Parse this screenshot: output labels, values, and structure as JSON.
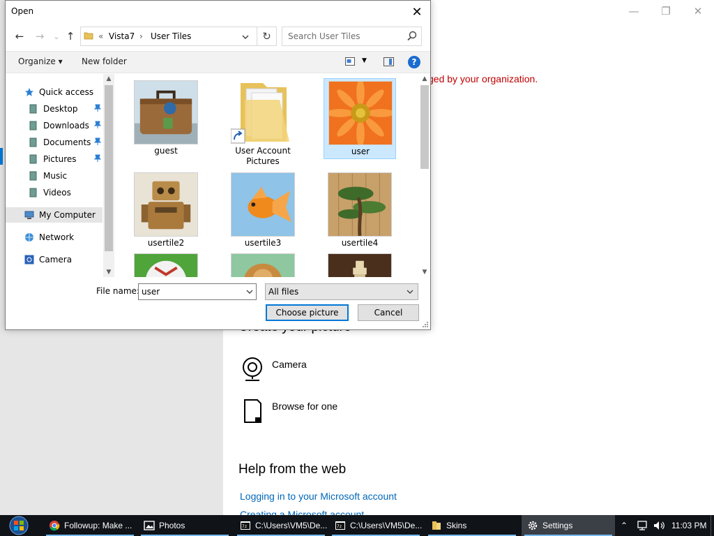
{
  "settings": {
    "window_controls": {
      "minimize": "—",
      "restore": "❐",
      "close": "✕"
    },
    "org_message": "ged by your organization.",
    "create_title": "Create your picture",
    "options": [
      {
        "label": "Camera",
        "icon": "camera-icon"
      },
      {
        "label": "Browse for one",
        "icon": "browse-file-icon"
      }
    ],
    "help_title": "Help from the web",
    "help_links": [
      "Logging in to your Microsoft account",
      "Creating a Microsoft account"
    ]
  },
  "dialog": {
    "title": "Open",
    "close_glyph": "✕",
    "nav": {
      "back": "←",
      "forward": "→",
      "recent": "⌄",
      "up": "↑"
    },
    "address": {
      "overflow": "«",
      "crumbs": [
        "Vista7",
        "User Tiles"
      ],
      "sep": "›",
      "refresh": "↻"
    },
    "search": {
      "placeholder": "Search User Tiles"
    },
    "toolbar": {
      "organize": "Organize ▾",
      "new_folder": "New folder",
      "view_drop": "▼",
      "help": "?"
    },
    "nav_pane": [
      {
        "label": "Quick access",
        "icon": "star-icon",
        "level": 0,
        "pinned": false,
        "selected": false
      },
      {
        "label": "Desktop",
        "icon": "desktop-icon",
        "level": 1,
        "pinned": true,
        "selected": false
      },
      {
        "label": "Downloads",
        "icon": "downloads-icon",
        "level": 1,
        "pinned": true,
        "selected": false
      },
      {
        "label": "Documents",
        "icon": "documents-icon",
        "level": 1,
        "pinned": true,
        "selected": false
      },
      {
        "label": "Pictures",
        "icon": "pictures-icon",
        "level": 1,
        "pinned": true,
        "selected": false
      },
      {
        "label": "Music",
        "icon": "music-icon",
        "level": 1,
        "pinned": false,
        "selected": false
      },
      {
        "label": "Videos",
        "icon": "videos-icon",
        "level": 1,
        "pinned": false,
        "selected": false
      },
      {
        "label": "My Computer",
        "icon": "computer-icon",
        "level": 0,
        "pinned": false,
        "selected": true
      },
      {
        "label": "Network",
        "icon": "network-icon",
        "level": 0,
        "pinned": false,
        "selected": false
      },
      {
        "label": "Camera",
        "icon": "camera-icon",
        "level": 0,
        "pinned": false,
        "selected": false
      }
    ],
    "files": [
      {
        "name": "guest",
        "kind": "suitcase"
      },
      {
        "name": "User Account Pictures",
        "kind": "folder"
      },
      {
        "name": "user",
        "kind": "flower",
        "selected": true
      },
      {
        "name": "usertile2",
        "kind": "robot"
      },
      {
        "name": "usertile3",
        "kind": "fish"
      },
      {
        "name": "usertile4",
        "kind": "bonsai"
      },
      {
        "name": "",
        "kind": "ball"
      },
      {
        "name": "",
        "kind": "puppy"
      },
      {
        "name": "",
        "kind": "chess"
      }
    ],
    "file_name_label": "File name:",
    "file_name_value": "user",
    "file_type_value": "All files",
    "buttons": {
      "ok": "Choose picture",
      "cancel": "Cancel"
    },
    "scroll_arrows": {
      "up": "▲",
      "down": "▼"
    }
  },
  "taskbar": {
    "tasks": [
      {
        "label": "Followup: Make ...",
        "icon": "chrome-icon",
        "active": false
      },
      {
        "label": "Photos",
        "icon": "photos-icon",
        "active": false
      },
      {
        "label": "C:\\Users\\VM5\\De...",
        "icon": "cmd-icon",
        "active": false
      },
      {
        "label": "C:\\Users\\VM5\\De...",
        "icon": "cmd-icon",
        "active": false
      },
      {
        "label": "Skins",
        "icon": "folder-icon",
        "active": false
      },
      {
        "label": "Settings",
        "icon": "gear-icon",
        "active": true
      }
    ],
    "tray": {
      "chevron": "⌃",
      "clock": "11:03 PM"
    }
  },
  "colors": {
    "accent": "#0078d7",
    "link": "#0067b8",
    "warning": "#c00000",
    "taskbar": "#101318",
    "selection": "#cce8ff"
  }
}
